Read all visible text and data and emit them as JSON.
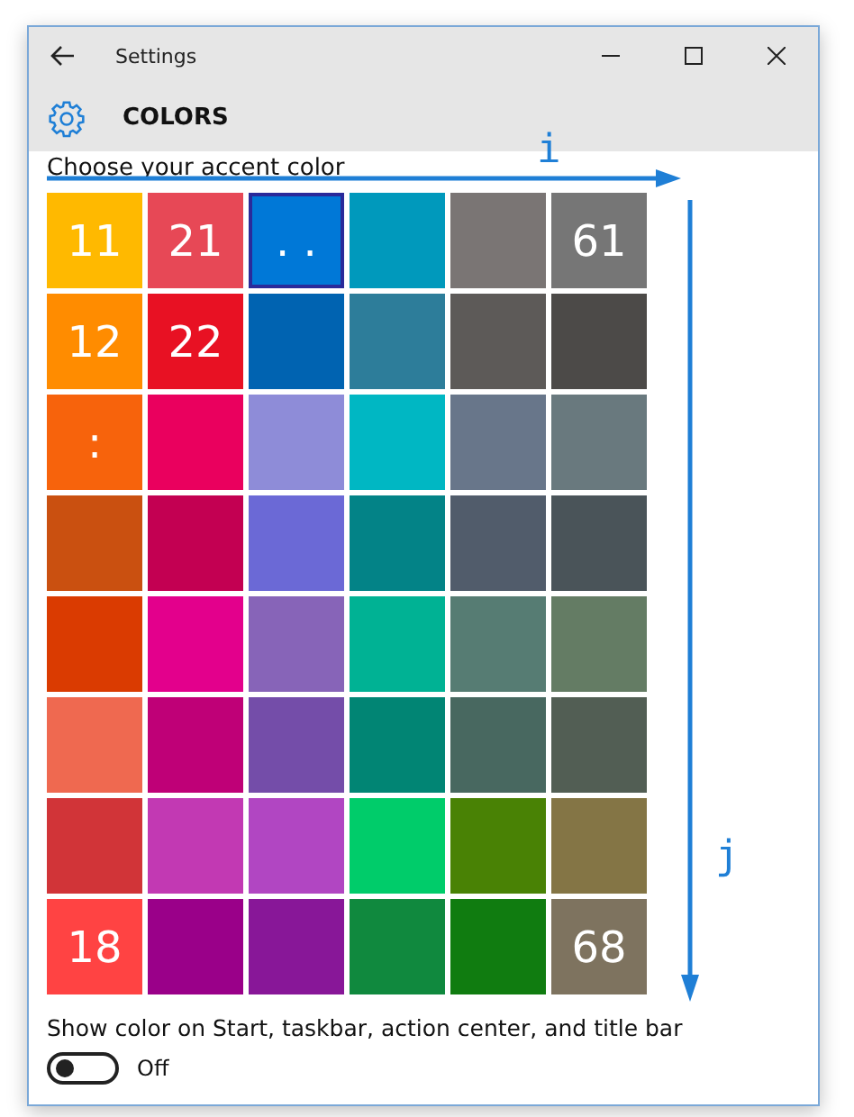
{
  "window": {
    "title": "Settings"
  },
  "header": {
    "title": "COLORS"
  },
  "accent": {
    "label": "Choose your accent color",
    "rows": [
      [
        {
          "color": "#ffb900",
          "label": "11",
          "selected": false
        },
        {
          "color": "#e74856",
          "label": "21",
          "selected": false
        },
        {
          "color": "#0078d7",
          "label": ". .",
          "selected": true
        },
        {
          "color": "#0099bc",
          "selected": false
        },
        {
          "color": "#7a7574",
          "selected": false
        },
        {
          "color": "#767676",
          "label": "61",
          "selected": false
        }
      ],
      [
        {
          "color": "#ff8c00",
          "label": "12",
          "selected": false
        },
        {
          "color": "#e81123",
          "label": "22",
          "selected": false
        },
        {
          "color": "#0063b1",
          "selected": false
        },
        {
          "color": "#2d7d9a",
          "selected": false
        },
        {
          "color": "#5d5a58",
          "selected": false
        },
        {
          "color": "#4c4a48",
          "selected": false
        }
      ],
      [
        {
          "color": "#f7630c",
          "label": ":",
          "selected": false
        },
        {
          "color": "#ea005e",
          "selected": false
        },
        {
          "color": "#8e8cd8",
          "selected": false
        },
        {
          "color": "#00b7c3",
          "selected": false
        },
        {
          "color": "#68768a",
          "selected": false
        },
        {
          "color": "#69797e",
          "selected": false
        }
      ],
      [
        {
          "color": "#ca5010",
          "selected": false
        },
        {
          "color": "#c30052",
          "selected": false
        },
        {
          "color": "#6b69d6",
          "selected": false
        },
        {
          "color": "#038387",
          "selected": false
        },
        {
          "color": "#515c6b",
          "selected": false
        },
        {
          "color": "#4a5459",
          "selected": false
        }
      ],
      [
        {
          "color": "#da3b01",
          "selected": false
        },
        {
          "color": "#e3008c",
          "selected": false
        },
        {
          "color": "#8764b8",
          "selected": false
        },
        {
          "color": "#00b294",
          "selected": false
        },
        {
          "color": "#567c73",
          "selected": false
        },
        {
          "color": "#647c64",
          "selected": false
        }
      ],
      [
        {
          "color": "#ef6950",
          "selected": false
        },
        {
          "color": "#bf0077",
          "selected": false
        },
        {
          "color": "#744da9",
          "selected": false
        },
        {
          "color": "#018574",
          "selected": false
        },
        {
          "color": "#486860",
          "selected": false
        },
        {
          "color": "#525e54",
          "selected": false
        }
      ],
      [
        {
          "color": "#d13438",
          "selected": false
        },
        {
          "color": "#c239b3",
          "selected": false
        },
        {
          "color": "#b146c2",
          "selected": false
        },
        {
          "color": "#00cc6a",
          "selected": false
        },
        {
          "color": "#498205",
          "selected": false
        },
        {
          "color": "#847545",
          "selected": false
        }
      ],
      [
        {
          "color": "#ff4343",
          "label": "18",
          "selected": false
        },
        {
          "color": "#9a0089",
          "selected": false
        },
        {
          "color": "#881798",
          "selected": false
        },
        {
          "color": "#10893e",
          "selected": false
        },
        {
          "color": "#107c10",
          "selected": false
        },
        {
          "color": "#7e735f",
          "label": "68",
          "selected": false
        }
      ]
    ]
  },
  "annotations": {
    "horizontal": {
      "label": "i"
    },
    "vertical": {
      "label": "j"
    }
  },
  "show_color": {
    "label": "Show color on Start, taskbar, action center, and title bar",
    "on": false,
    "state_label": "Off"
  }
}
